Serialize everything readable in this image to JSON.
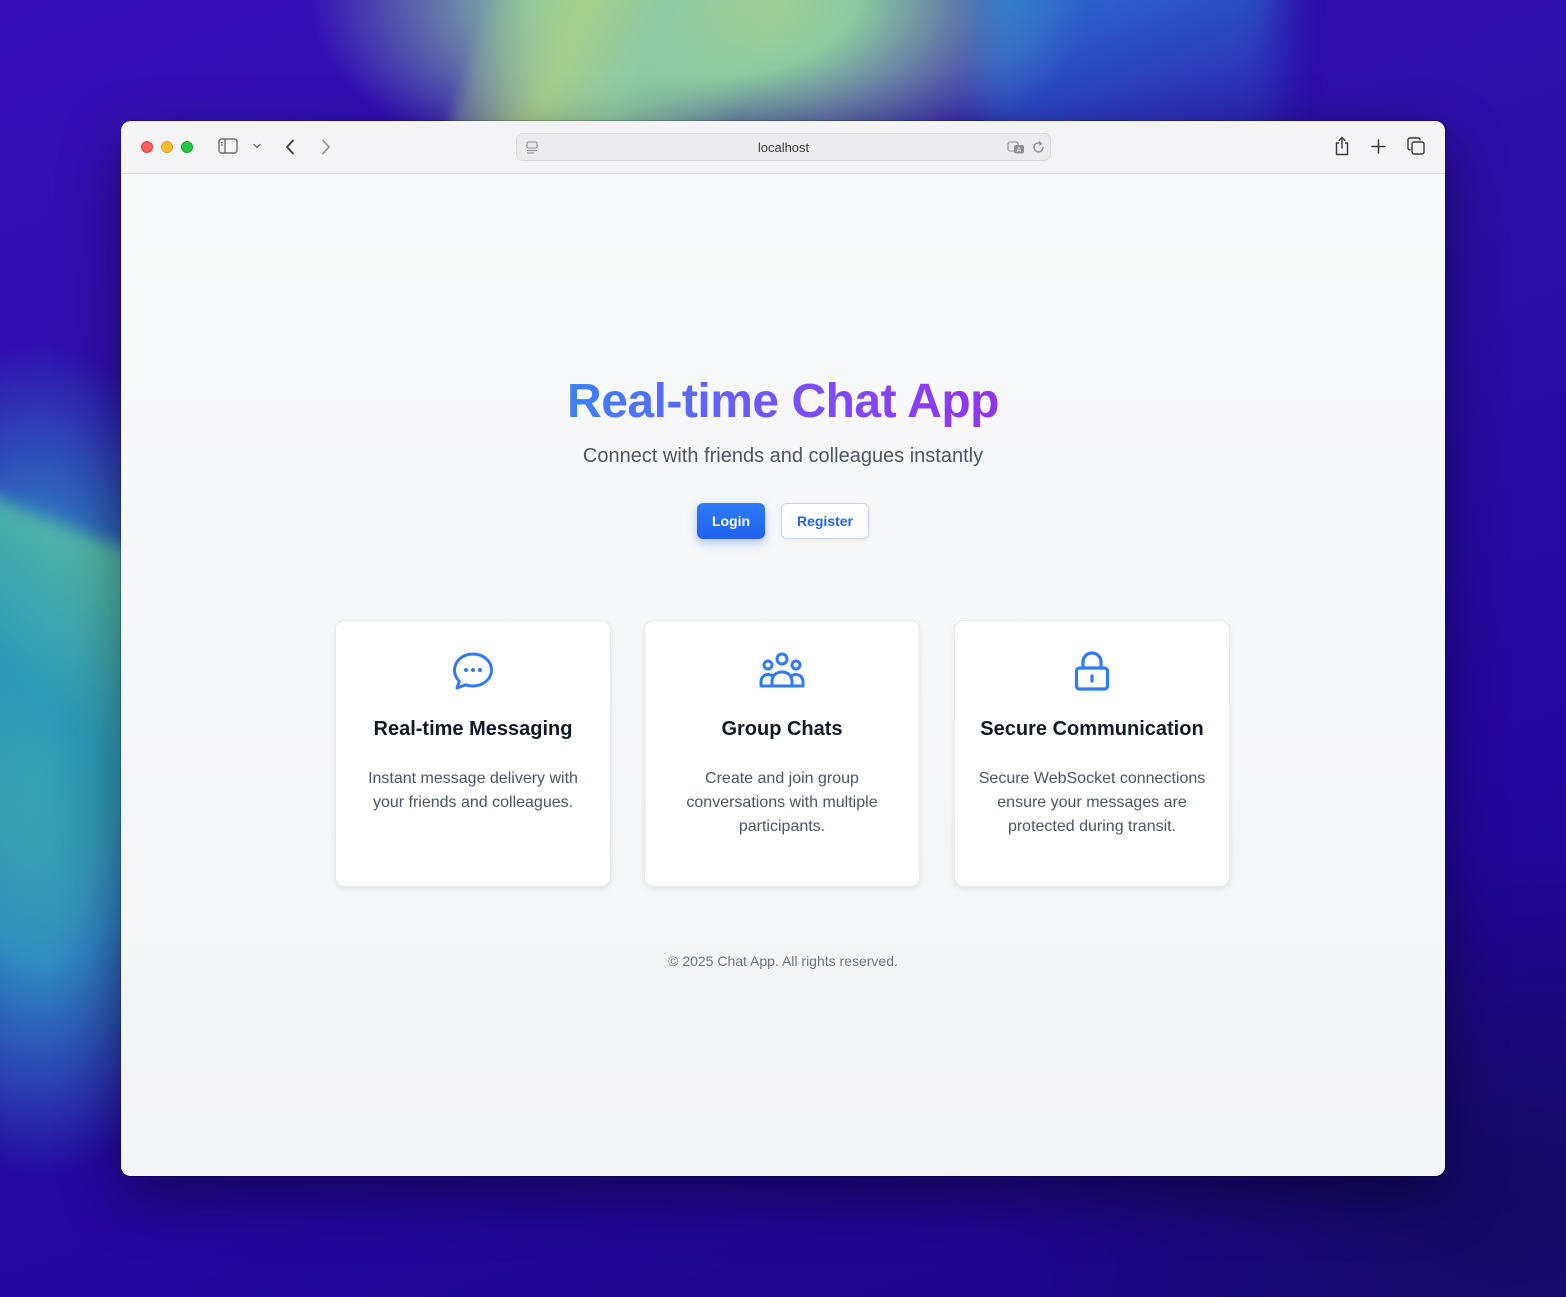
{
  "browser": {
    "url": "localhost",
    "icons": {
      "sidebar": "sidebar-icon",
      "back": "chevron-left-icon",
      "forward": "chevron-right-icon",
      "share": "share-icon",
      "new_tab": "plus-icon",
      "tabs": "tabs-overview-icon",
      "translate": "translate-icon",
      "reload": "reload-icon"
    }
  },
  "hero": {
    "title": "Real-time Chat App",
    "subtitle": "Connect with friends and colleagues instantly",
    "login_label": "Login",
    "register_label": "Register"
  },
  "features": [
    {
      "icon": "chat-bubble-icon",
      "title": "Real-time Messaging",
      "description": "Instant message delivery with your friends and colleagues."
    },
    {
      "icon": "users-group-icon",
      "title": "Group Chats",
      "description": "Create and join group conversations with multiple participants."
    },
    {
      "icon": "lock-icon",
      "title": "Secure Communication",
      "description": "Secure WebSocket connections ensure your messages are protected during transit."
    }
  ],
  "footer": {
    "copyright": "© 2025 Chat App. All rights reserved."
  },
  "colors": {
    "accent": "#2563eb",
    "gradient_start": "#3b82f6",
    "gradient_end": "#9333ea"
  }
}
